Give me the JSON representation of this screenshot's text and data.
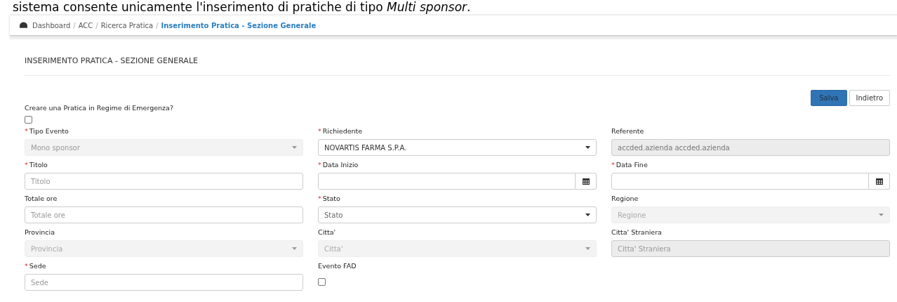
{
  "intro_text": "sistema consente unicamente l'inserimento di pratiche di tipo *Multi sponsor*.",
  "breadcrumb": [
    {
      "label": "Dashboard",
      "current": false
    },
    {
      "separator": "/",
      "label": "ACC",
      "current": false
    },
    {
      "separator": "/",
      "label": "Ricerca Pratica",
      "current": false
    },
    {
      "separator": "/",
      "label": "Inserimento Pratica - Sezione Generale",
      "current": true
    }
  ],
  "page_title": "INSERIMENTO PRATICA - SEZIONE GENERALE",
  "buttons": [
    {
      "label": "Salva",
      "kind": "primary"
    },
    {
      "label": "Indietro",
      "kind": "default"
    }
  ],
  "emergency": {
    "label": "Creare una Pratica in Regime di Emergenza?",
    "checked": false
  },
  "fields": [
    {
      "kind": "select",
      "required_mark": "*",
      "label": "Tipo Evento",
      "value": "Mono sponsor",
      "disabled": true
    },
    {
      "kind": "select",
      "required_mark": "*",
      "label": "Richiedente",
      "value": "NOVARTIS FARMA S.P.A.",
      "disabled": false
    },
    {
      "kind": "text",
      "label": "Referente",
      "value": "accded.azienda accded.azienda",
      "disabled": true
    },
    {
      "kind": "text",
      "required_mark": "*",
      "label": "Titolo",
      "placeholder": "Titolo",
      "disabled": false
    },
    {
      "kind": "date",
      "required_mark": "*",
      "label": "Data Inizio",
      "disabled": false
    },
    {
      "kind": "date",
      "required_mark": "*",
      "label": "Data Fine",
      "disabled": false
    },
    {
      "kind": "text",
      "label": "Totale ore",
      "placeholder": "Totale ore",
      "disabled": false
    },
    {
      "kind": "select",
      "required_mark": "*",
      "label": "Stato",
      "placeholder": "Stato",
      "disabled": false
    },
    {
      "kind": "select",
      "label": "Regione",
      "placeholder": "Regione",
      "disabled": true
    },
    {
      "kind": "select",
      "label": "Provincia",
      "placeholder": "Provincia",
      "disabled": true
    },
    {
      "kind": "select",
      "label": "Citta'",
      "placeholder": "Citta'",
      "disabled": true
    },
    {
      "kind": "text",
      "label": "Citta' Straniera",
      "placeholder": "Citta' Straniera",
      "disabled": true
    },
    {
      "kind": "text",
      "required_mark": "*",
      "label": "Sede",
      "placeholder": "Sede",
      "disabled": false
    },
    {
      "kind": "checkbox",
      "label": "Evento FAD",
      "checked": false
    }
  ]
}
